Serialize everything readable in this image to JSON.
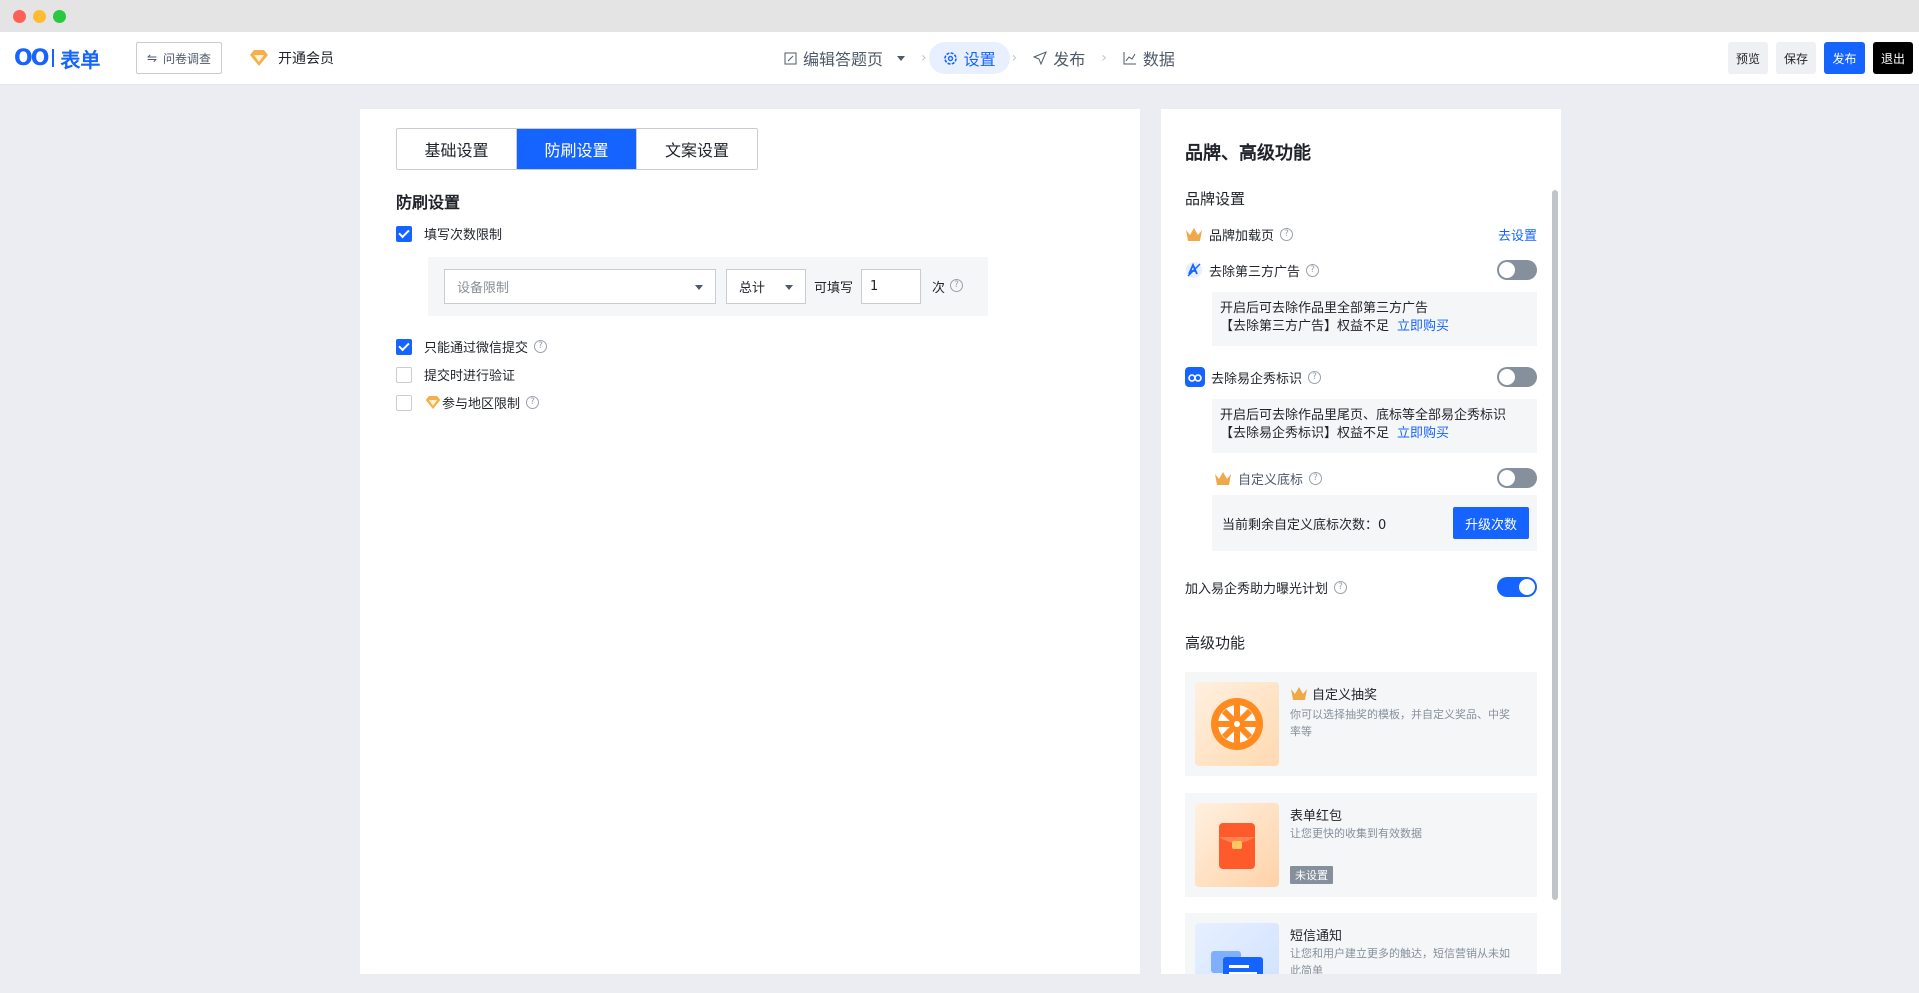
{
  "header": {
    "logo_mark": "OO",
    "logo_text": "表单",
    "survey_button": "问卷调查",
    "vip_link": "开通会员",
    "nav": [
      {
        "label": "编辑答题页",
        "icon": "edit-icon"
      },
      {
        "label": "设置",
        "icon": "gear-icon"
      },
      {
        "label": "发布",
        "icon": "send-icon"
      },
      {
        "label": "数据",
        "icon": "chart-icon"
      }
    ],
    "buttons": {
      "preview": "预览",
      "save": "保存",
      "publish": "发布",
      "exit": "退出"
    }
  },
  "tabs": [
    "基础设置",
    "防刷设置",
    "文案设置"
  ],
  "active_tab": "防刷设置",
  "anti_spam": {
    "title": "防刷设置",
    "fill_limit": {
      "label": "填写次数限制",
      "checked": true
    },
    "device_placeholder": "设备限制",
    "period": "总计",
    "can_fill_label": "可填写",
    "count_value": "1",
    "times_label": "次",
    "wechat_only": {
      "label": "只能通过微信提交",
      "checked": true
    },
    "verify_on_submit": {
      "label": "提交时进行验证",
      "checked": false
    },
    "region_limit": {
      "label": "参与地区限制",
      "checked": false
    }
  },
  "brand": {
    "title": "品牌、高级功能",
    "section": "品牌设置",
    "loading_page": {
      "label": "品牌加载页",
      "action": "去设置"
    },
    "remove_ads": {
      "label": "去除第三方广告",
      "enabled": false,
      "info_line1": "开启后可去除作品里全部第三方广告",
      "info_line2": "【去除第三方广告】权益不足",
      "buy": "立即购买"
    },
    "remove_logo": {
      "label": "去除易企秀标识",
      "enabled": false,
      "info_line1": "开启后可去除作品里尾页、底标等全部易企秀标识",
      "info_line2": "【去除易企秀标识】权益不足",
      "buy": "立即购买"
    },
    "custom_footer": {
      "label": "自定义底标",
      "enabled": false,
      "remaining_text": "当前剩余自定义底标次数：0",
      "upgrade": "升级次数"
    },
    "exposure_plan": {
      "label": "加入易企秀助力曝光计划",
      "enabled": true
    }
  },
  "advanced": {
    "title": "高级功能",
    "cards": [
      {
        "title": "自定义抽奖",
        "desc": "你可以选择抽奖的模板，并自定义奖品、中奖率等",
        "vip": true
      },
      {
        "title": "表单红包",
        "desc": "让您更快的收集到有效数据",
        "tag": "未设置"
      },
      {
        "title": "短信通知",
        "desc": "让您和用户建立更多的触达，短信营销从未如此简单"
      }
    ]
  },
  "colors": {
    "accent": "#1664ff",
    "background": "#ebedf3"
  }
}
